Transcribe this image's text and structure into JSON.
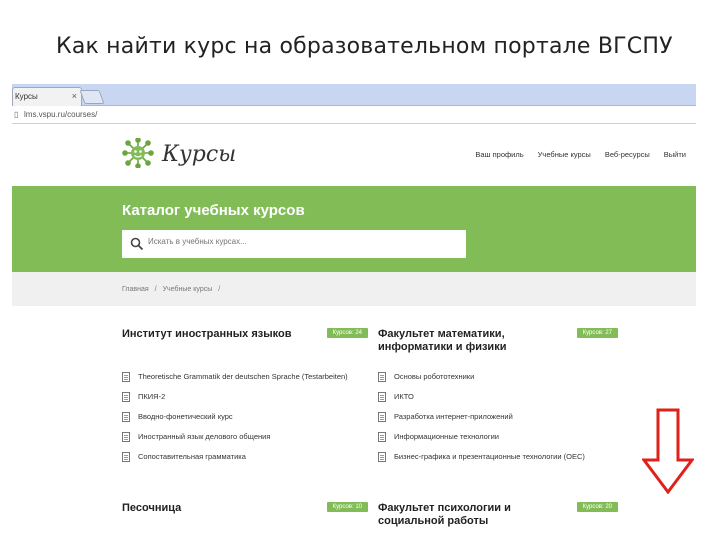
{
  "slide": {
    "title": "Как найти курс на образовательном портале ВГСПУ"
  },
  "browser": {
    "tab_label": "Курсы",
    "tab_close": "×",
    "url": "lms.vspu.ru/courses/"
  },
  "site": {
    "logo_text": "Курсы",
    "nav": [
      "Ваш профиль",
      "Учебные курсы",
      "Веб-ресурсы",
      "Выйти"
    ],
    "hero_title": "Каталог учебных курсов",
    "search_placeholder": "Искать в учебных курсах...",
    "breadcrumb": [
      "Главная",
      "/",
      "Учебные курсы",
      "/"
    ]
  },
  "faculties": [
    {
      "title": "Институт иностранных языков",
      "badge": "Курсов: 24",
      "courses": [
        "Theoretische Grammatik der deutschen Sprache (Testarbeiten)",
        "ПКИЯ-2",
        "Вводно-фонетический курс",
        "Иностранный язык делового общения",
        "Сопоставительная грамматика"
      ]
    },
    {
      "title": "Факультет математики, информатики и физики",
      "badge": "Курсов: 27",
      "courses": [
        "Основы робототехники",
        "ИКТО",
        "Разработка интернет-приложений",
        "Информационные технологии",
        "Бизнес-графика и презентационные технологии (ОЕС)"
      ]
    }
  ],
  "bottom_faculties": [
    {
      "title": "Песочница",
      "badge": "Курсов: 10"
    },
    {
      "title": "Факультет психологии и социальной работы",
      "badge": "Курсов: 20"
    }
  ],
  "colors": {
    "accent_green": "#82bc57",
    "arrow_red": "#e0201b",
    "tabbar": "#c9d6f2"
  }
}
